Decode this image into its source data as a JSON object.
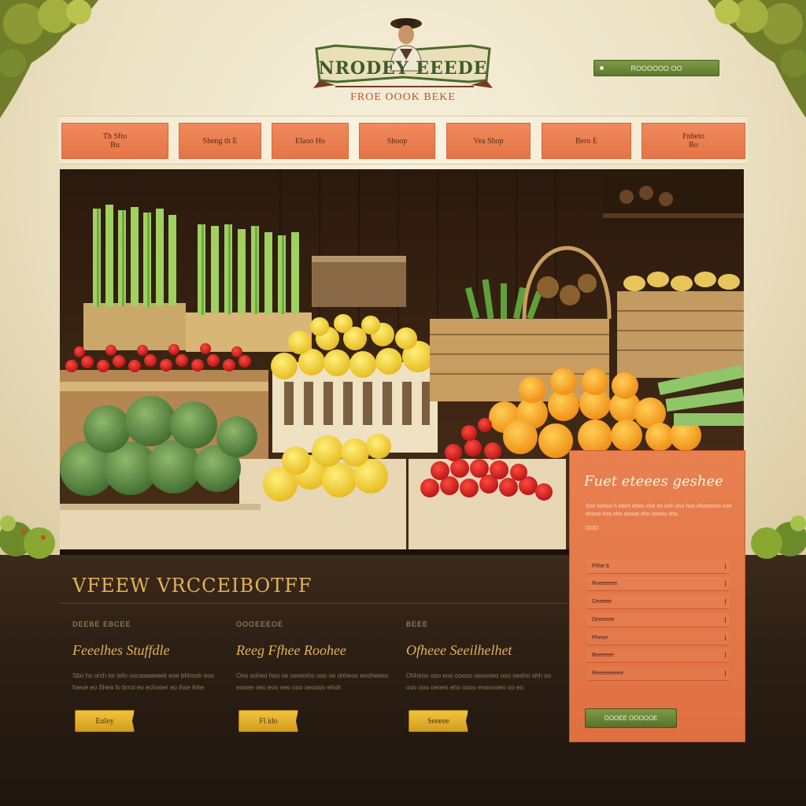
{
  "header": {
    "logo_text": "NRODEY EEEDE",
    "tagline": "FROE OOOK BEKE",
    "top_button_label": "ROOOOOO OO"
  },
  "nav": [
    {
      "label": "Th Sfto\nBu"
    },
    {
      "label": "Sheng th E"
    },
    {
      "label": "Elaoo Ho"
    },
    {
      "label": "Shoop"
    },
    {
      "label": "Vea Shop"
    },
    {
      "label": "Bero E"
    },
    {
      "label": "Fnheto\nBo"
    }
  ],
  "hero": {
    "image_icon": "produce-market-photo"
  },
  "section": {
    "title": "VFEEW VRCCEIBOTFF"
  },
  "columns": [
    {
      "kicker": "DEEBE EBCEE",
      "heading": "Feeelhes Stuffdle",
      "body": "Sbo ho orch lor tefo oocaaaaeeek eoe bhhooh eoo foeoe eo Shea fo brrot eo echooer eo ihse ihhe",
      "button": "Euley"
    },
    {
      "kicker": "OOOEEEOE",
      "heading": "Reeg Ffhee Roohee",
      "body": "Ooo ooheo hoo oe oeoeoho ooo oe ohheoo eooheeoo eooee oeo eoo oeo ooo oeoooo ehoh",
      "button": "Fl ido"
    },
    {
      "kicker": "BEEE",
      "heading": "Ofheee Seeilhelhet",
      "body": "Ohheoo ooo eoo ooeoo oeoooeo ooo oeeho ohh oo ooo ooo oeoeo eho oooo eoooooeo oo eo",
      "button": "Seeeee"
    }
  ],
  "sidebar": {
    "title": "Fuet eteees geshee",
    "body": "Soo hebeo h ebeh eheo ehe oo eoh oho hoo ehoeeeoo eoe eheoo hoo eho oeooe eho ooeeo eho",
    "small": "OOO",
    "fields": [
      "Fhhe tt",
      "Roeeeeee",
      "Geeeee",
      "Deeeeee",
      "Pheoe",
      "Beeeeee",
      "Reeeeeeeee"
    ],
    "submit": "OOOEE OOOOOE"
  },
  "colors": {
    "nav_orange": "#e97b4c",
    "sidebar_orange": "#e3774a",
    "green_button": "#6a8736",
    "gold_button": "#e2b02c",
    "dark_band": "#2f2116",
    "gold_text": "#e2b25a"
  }
}
